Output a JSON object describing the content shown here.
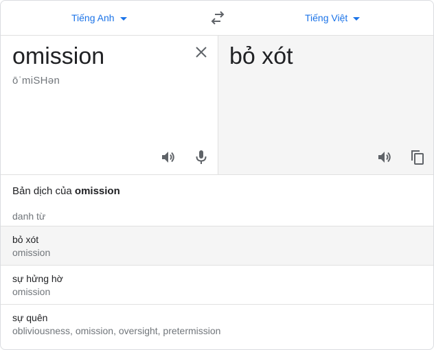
{
  "lang": {
    "source": "Tiếng Anh",
    "target": "Tiếng Việt"
  },
  "source": {
    "text": "omission",
    "phonetic": "ōˈmiSHən"
  },
  "target": {
    "text": "bỏ xót"
  },
  "icons": {
    "swap": "swap-icon",
    "clear": "close-icon",
    "listen_source": "speaker-icon",
    "mic": "mic-icon",
    "listen_target": "speaker-icon",
    "copy": "copy-icon"
  },
  "dictionary": {
    "title_prefix": "Bản dịch của ",
    "title_word": "omission",
    "part_of_speech": "danh từ",
    "entries": [
      {
        "term": "bỏ xót",
        "synonyms": "omission"
      },
      {
        "term": "sự hửng hờ",
        "synonyms": "omission"
      },
      {
        "term": "sự quên",
        "synonyms": "obliviousness, omission, oversight, pretermission"
      }
    ]
  },
  "colors": {
    "accent": "#1a73e8",
    "text": "#202124",
    "muted": "#70757a",
    "icon": "#5f6368"
  }
}
